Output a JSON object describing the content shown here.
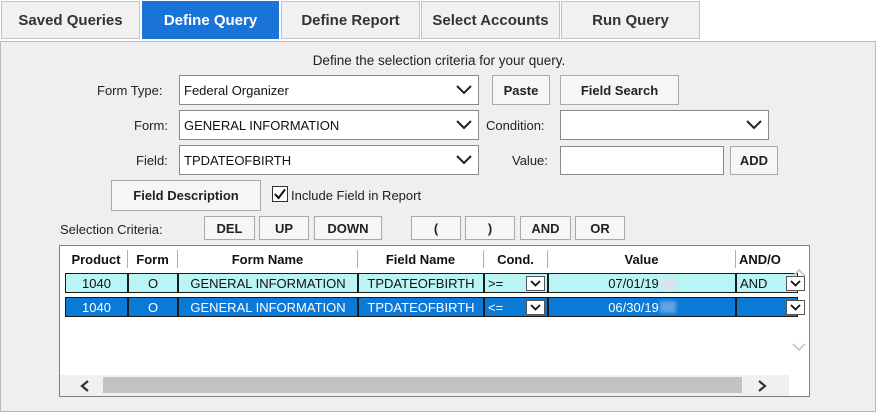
{
  "tabs": [
    "Saved Queries",
    "Define Query",
    "Define Report",
    "Select Accounts",
    "Run Query"
  ],
  "active_tab": "Define Query",
  "instructions": "Define the selection criteria for your query.",
  "form_type": {
    "label": "Form Type:",
    "value": "Federal Organizer"
  },
  "form": {
    "label": "Form:",
    "value": "GENERAL INFORMATION"
  },
  "field": {
    "label": "Field:",
    "value": "TPDATEOFBIRTH"
  },
  "condition": {
    "label": "Condition:",
    "value": ""
  },
  "value_field": {
    "label": "Value:",
    "value": ""
  },
  "buttons": {
    "paste": "Paste",
    "field_search": "Field Search",
    "add": "ADD",
    "field_description": "Field Description"
  },
  "include_checkbox": {
    "label": "Include Field in Report",
    "checked": true
  },
  "selection_criteria": {
    "label": "Selection Criteria:",
    "buttons": [
      "DEL",
      "UP",
      "DOWN",
      "(",
      ")",
      "AND",
      "OR"
    ]
  },
  "grid": {
    "headers": [
      "Product",
      "Form",
      "Form Name",
      "Field Name",
      "Cond.",
      "Value",
      "AND/O"
    ],
    "rows": [
      {
        "product": "1040",
        "form": "O",
        "form_name": "GENERAL INFORMATION",
        "field_name": "TPDATEOFBIRTH",
        "cond": ">=",
        "value": "07/01/19",
        "andor": "AND",
        "selected": false
      },
      {
        "product": "1040",
        "form": "O",
        "form_name": "GENERAL INFORMATION",
        "field_name": "TPDATEOFBIRTH",
        "cond": "<=",
        "value": "06/30/19",
        "andor": "",
        "selected": true
      }
    ]
  },
  "colors": {
    "accent": "#1a73d9",
    "row_highlight": "#b8f5f4",
    "row_selected": "#0a7ad6"
  }
}
